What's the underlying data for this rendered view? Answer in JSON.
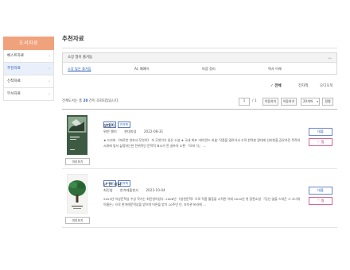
{
  "sidebar": {
    "title": "도서자료",
    "items": [
      {
        "label": "베스트자료",
        "active": false
      },
      {
        "label": "추천자료",
        "active": true
      },
      {
        "label": "신착자료",
        "active": false
      },
      {
        "label": "부서자료",
        "active": false
      }
    ]
  },
  "main": {
    "title": "추천자료",
    "filter": {
      "header": "소장 많이 즐겨둠",
      "options": [
        "소장 많은 즐겨둠",
        "AI, 예예이",
        "마음 정리",
        "역사 이해"
      ]
    },
    "view": {
      "selected": "전체",
      "option2": "전자책",
      "option3": "오디오북"
    },
    "toolbar": {
      "count_prefix": "전체도서는 총 ",
      "count_value": "20",
      "count_suffix": " 건이 조회되었습니다.",
      "page": "1",
      "page_total": "/ 1",
      "prev_label": "이동하기",
      "next_label": "이동하기",
      "per_page": "20개씩",
      "sort_label": "정렬"
    },
    "items": [
      {
        "badges": [
          "소장본",
          "전자책"
        ],
        "title": "모데지",
        "author": "위연 캘리",
        "publisher": "현대지성",
        "date": "2022-08-31",
        "desc": "★ 드라마 《마로만 연호사 무엇이》 속 무엇이가 읽은 소설 ★ 국내 최초 ‘레이먼드 비숍’ 작품을 엽려가서 수직 한역본 말대게 선비한을 감유하던 목적의 시대에 맞서 삶정하는한 전위적인 문학적 표시가 된 골프의 소편 『모비 딕』 ...",
        "cover_label": "미리보기",
        "loan_label": "대출",
        "like_label": "찜"
      },
      {
        "badges": [
          "소장본",
          "전자책"
        ],
        "title": "단 한 사람",
        "author": "최진영",
        "publisher": "한겨레출판사",
        "date": "2023-10-04",
        "desc": "2023년 이상문학상 수상 작가는 최진영이었다. 2006년 《실천문학》으로 작품 활동을 시작한 이래 2010년 첫 장편소설 『당신 옆을 스쳐간 그 소녀의 이름은』으로 한겨레문학상을 받으며 어른을 받기 10주년 년. 지자관 바라에 ...",
        "cover_label": "미리보기",
        "loan_label": "대출",
        "like_label": "찜"
      }
    ]
  }
}
